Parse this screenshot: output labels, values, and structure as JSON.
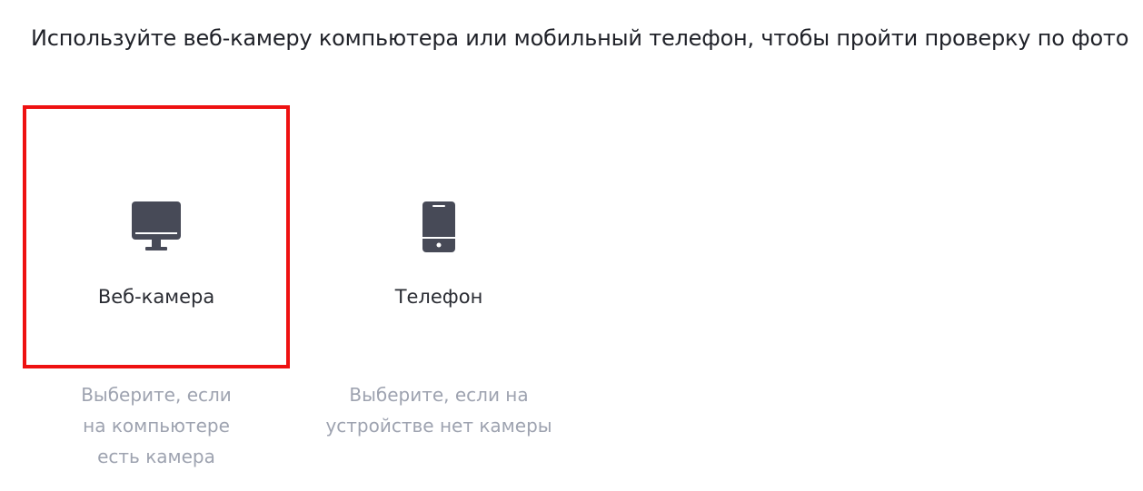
{
  "instruction": "Используйте веб-камеру компьютера или мобильный телефон, чтобы пройти проверку по фото",
  "options": [
    {
      "label": "Веб-камера",
      "description": "Выберите, если на компьютере есть камера",
      "icon": "monitor-icon",
      "selected": true
    },
    {
      "label": "Телефон",
      "description": "Выберите, если на устройстве нет камеры",
      "icon": "smartphone-icon",
      "selected": false
    }
  ],
  "colors": {
    "selection_border": "#ee1111",
    "icon": "#474a57",
    "description_text": "#9ea3b0"
  }
}
